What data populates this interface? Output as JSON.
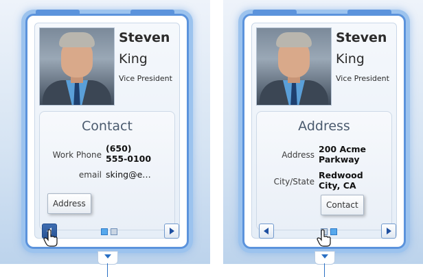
{
  "cards": [
    {
      "first_name": "Steven",
      "last_name": "King",
      "title": "Vice President",
      "section_title": "Contact",
      "rows": [
        {
          "label": "Work Phone",
          "value_line1": "(650)",
          "value_line2": "555-0100"
        },
        {
          "label": "email",
          "value_line1": "sking@e…",
          "value_line2": ""
        }
      ],
      "tooltip": "Address",
      "page_dots": [
        "active",
        "inactive"
      ]
    },
    {
      "first_name": "Steven",
      "last_name": "King",
      "title": "Vice President",
      "section_title": "Address",
      "rows": [
        {
          "label": "Address",
          "value_line1": "200 Acme",
          "value_line2": "Parkway"
        },
        {
          "label": "City/State",
          "value_line1": "Redwood",
          "value_line2": "City, CA"
        }
      ],
      "tooltip": "Contact",
      "page_dots": [
        "inactive",
        "active"
      ]
    }
  ],
  "icons": {
    "prev": "chevron-left-icon",
    "next": "chevron-right-icon",
    "cursor": "hand-pointer-icon"
  },
  "colors": {
    "frame": "#5b93dc",
    "glow": "#9cc3ee",
    "dot_active": "#56a8ec"
  }
}
